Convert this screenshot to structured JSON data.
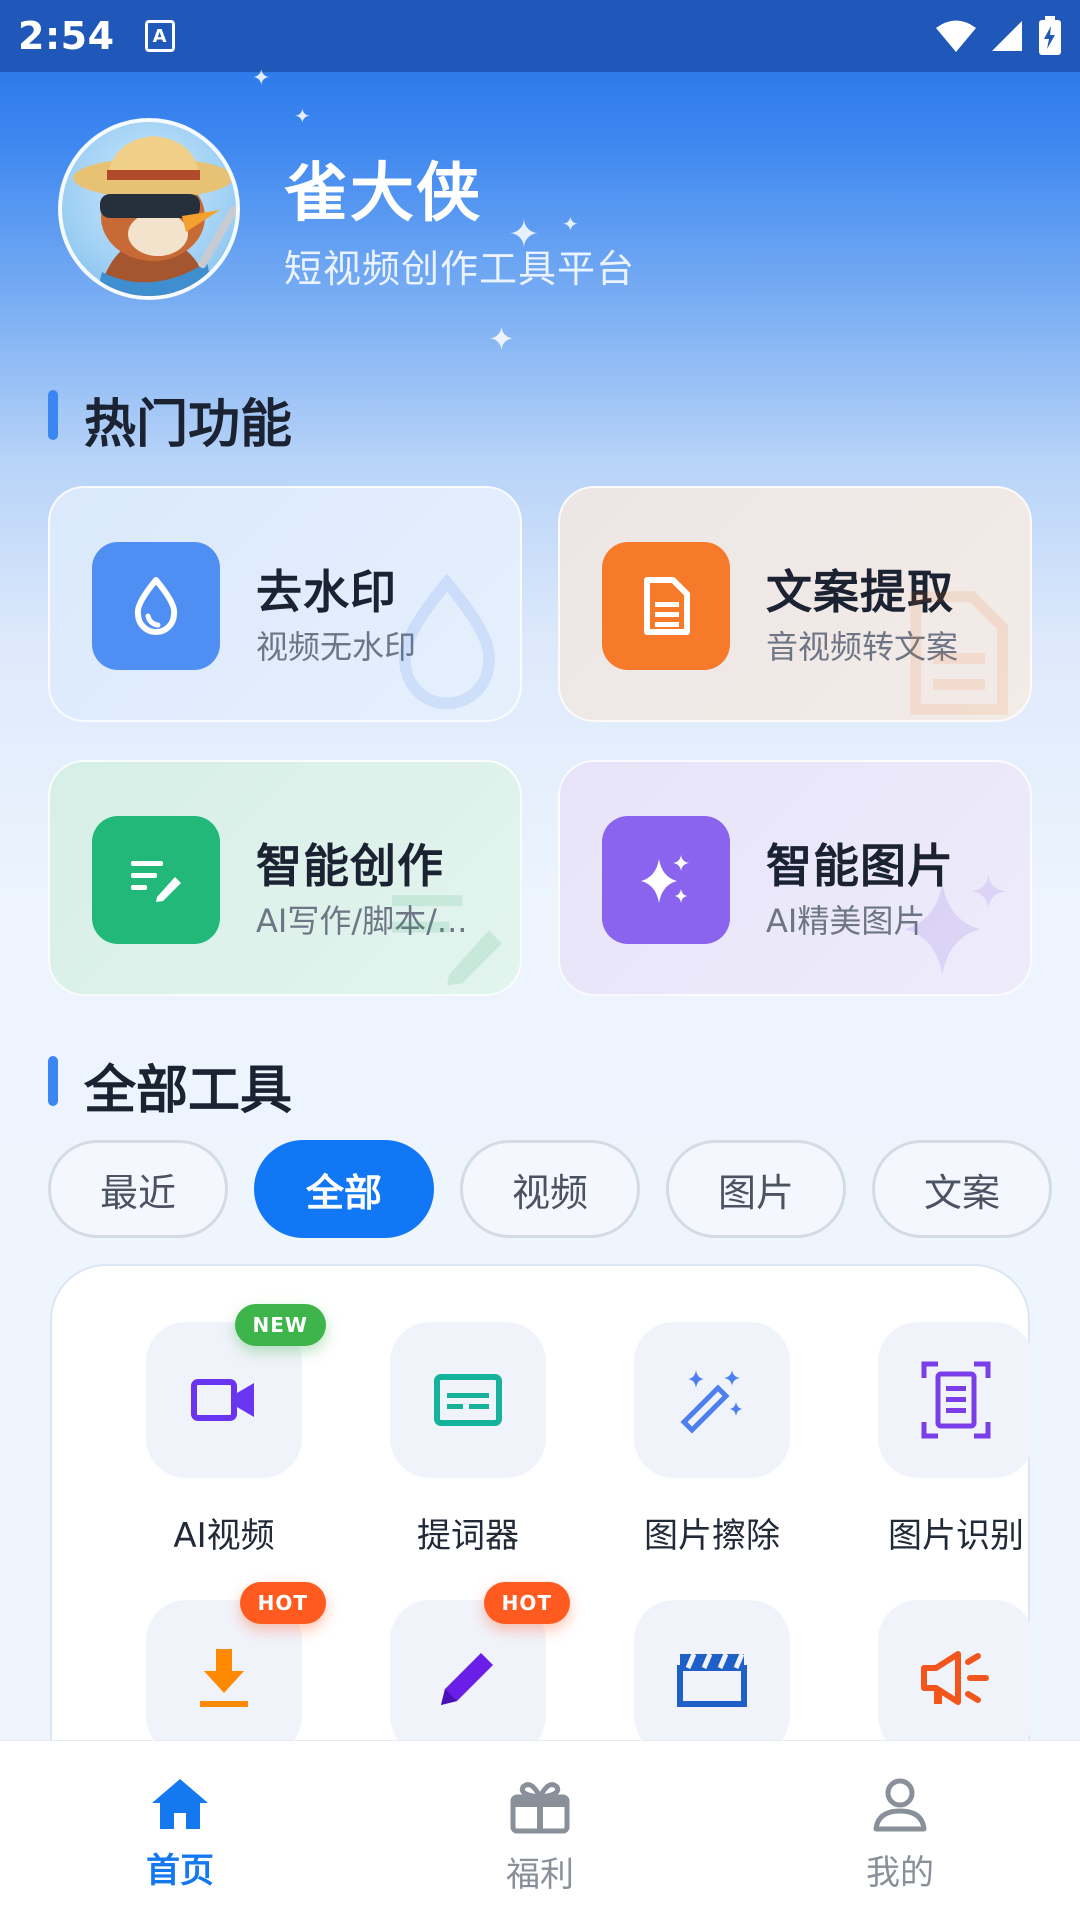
{
  "status_bar": {
    "time": "2:54",
    "notif_letter": "A"
  },
  "colors": {
    "primary": "#1177F5",
    "accent_bar": "#3B86F2",
    "hot_badge": "#FF5A1F",
    "new_badge": "#3DB54A"
  },
  "header": {
    "title": "雀大侠",
    "subtitle": "短视频创作工具平台"
  },
  "hot_section": {
    "title": "热门功能",
    "cards": [
      {
        "title": "去水印",
        "desc": "视频无水印",
        "icon": "water-drop-icon"
      },
      {
        "title": "文案提取",
        "desc": "音视频转文案",
        "icon": "document-icon"
      },
      {
        "title": "智能创作",
        "desc": "AI写作/脚本/...",
        "icon": "edit-lines-icon"
      },
      {
        "title": "智能图片",
        "desc": "AI精美图片",
        "icon": "sparkles-icon"
      }
    ]
  },
  "tools_section": {
    "title": "全部工具",
    "tabs": [
      "最近",
      "全部",
      "视频",
      "图片",
      "文案"
    ],
    "active_tab": "全部",
    "tools": [
      {
        "label": "AI视频",
        "icon": "video-camera-icon",
        "badge": "NEW"
      },
      {
        "label": "提词器",
        "icon": "subtitle-icon",
        "badge": ""
      },
      {
        "label": "图片擦除",
        "icon": "magic-wand-icon",
        "badge": ""
      },
      {
        "label": "图片识别",
        "icon": "scan-document-icon",
        "badge": ""
      },
      {
        "label": "",
        "icon": "download-icon",
        "badge": "HOT"
      },
      {
        "label": "",
        "icon": "pencil-icon",
        "badge": "HOT"
      },
      {
        "label": "",
        "icon": "clapperboard-icon",
        "badge": ""
      },
      {
        "label": "",
        "icon": "megaphone-icon",
        "badge": ""
      }
    ]
  },
  "bottom_nav": {
    "items": [
      {
        "label": "首页",
        "icon": "home-icon",
        "active": true
      },
      {
        "label": "福利",
        "icon": "gift-icon",
        "active": false
      },
      {
        "label": "我的",
        "icon": "user-icon",
        "active": false
      }
    ]
  }
}
